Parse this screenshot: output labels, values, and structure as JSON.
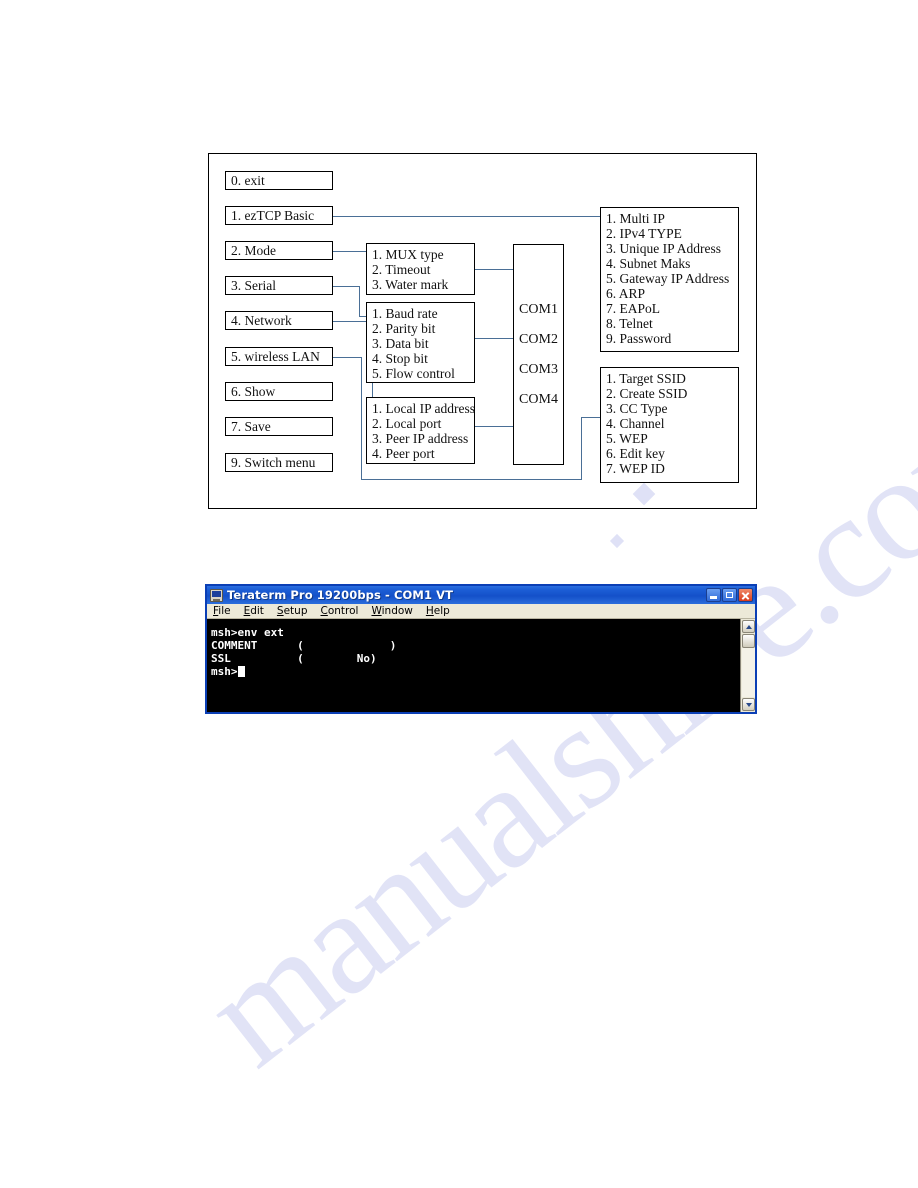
{
  "watermark": {
    "text": "manualshive.com"
  },
  "diagram": {
    "main_menu": [
      {
        "label": "0. exit"
      },
      {
        "label": "1. ezTCP Basic"
      },
      {
        "label": "2. Mode"
      },
      {
        "label": "3. Serial"
      },
      {
        "label": "4. Network"
      },
      {
        "label": "5. wireless LAN"
      },
      {
        "label": "6. Show"
      },
      {
        "label": "7. Save"
      },
      {
        "label": "9. Switch menu"
      }
    ],
    "mode_box": {
      "items": [
        "1. MUX type",
        "2. Timeout",
        "3. Water mark"
      ]
    },
    "serial_box": {
      "items": [
        "1. Baud rate",
        "2. Parity bit",
        "3. Data bit",
        "4. Stop bit",
        "5. Flow control"
      ]
    },
    "network_box": {
      "items": [
        "1. Local IP address",
        "2. Local port",
        "3. Peer IP address",
        "4. Peer port"
      ]
    },
    "com_box": {
      "items": [
        "COM1",
        "COM2",
        "COM3",
        "COM4"
      ]
    },
    "eztcp_basic_box": {
      "items": [
        "1. Multi IP",
        "2. IPv4 TYPE",
        "3. Unique IP Address",
        "4. Subnet Maks",
        "5. Gateway IP Address",
        "6. ARP",
        "7. EAPoL",
        "8. Telnet",
        "9. Password"
      ]
    },
    "wireless_lan_box": {
      "items": [
        "1. Target SSID",
        "2. Create SSID",
        "3. CC Type",
        "4. Channel",
        "5. WEP",
        "6. Edit key",
        "7. WEP ID"
      ]
    }
  },
  "terminal": {
    "title": "Teraterm Pro 19200bps - COM1 VT",
    "icon": "terminal-computer-icon",
    "window_buttons": {
      "minimize": "minimize-icon",
      "maximize": "maximize-icon",
      "close": "close-icon"
    },
    "menu": [
      {
        "label": "File",
        "accel": "F",
        "rest": "ile"
      },
      {
        "label": "Edit",
        "accel": "E",
        "rest": "dit"
      },
      {
        "label": "Setup",
        "accel": "S",
        "rest": "etup"
      },
      {
        "label": "Control",
        "accel": "C",
        "rest": "ontrol"
      },
      {
        "label": "Window",
        "accel": "W",
        "rest": "indow"
      },
      {
        "label": "Help",
        "accel": "H",
        "rest": "elp"
      }
    ],
    "console_lines": [
      "msh>env ext",
      "COMMENT      (             )",
      "SSL          (        No)",
      "msh>"
    ],
    "scrollbar": {
      "up": "scroll-up-icon",
      "down": "scroll-down-icon"
    }
  },
  "colors": {
    "title_bar": "#1450c9",
    "connector": "#4a6f96",
    "terminal_bg": "#000000",
    "menu_bg": "#ece9d8",
    "watermark": "#c9cdf0"
  }
}
